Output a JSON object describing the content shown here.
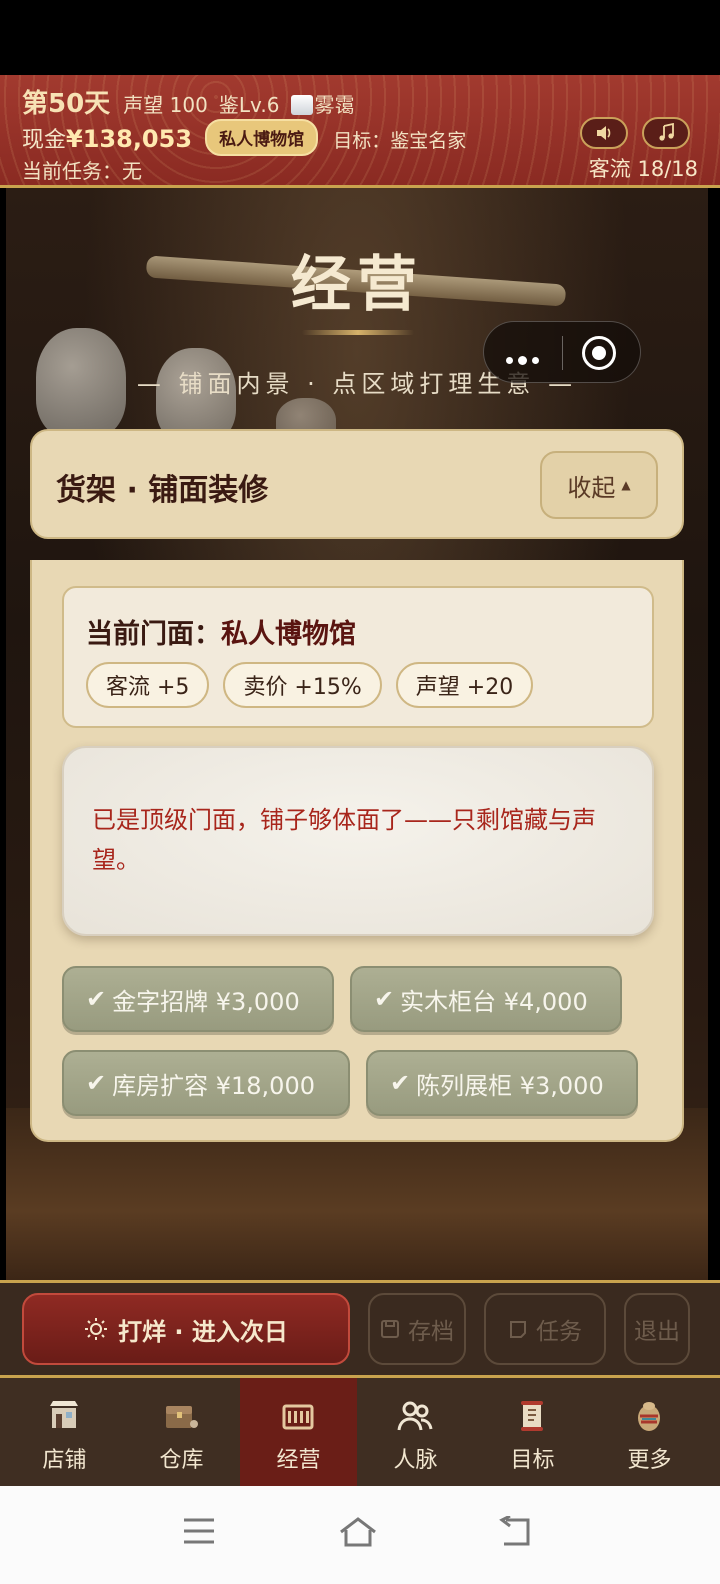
{
  "header": {
    "day": "第50天",
    "reputation": "声望 100",
    "appraisal_level": "鉴Lv.6",
    "weather": "雾霭",
    "cash_label": "现金",
    "cash_value": "¥138,053",
    "museum_badge": "私人博物馆",
    "goal": "目标：鉴宝名家",
    "current_task": "当前任务：无",
    "visitor_flow": "客流 18/18",
    "sound_icon": "speaker-icon",
    "music_icon": "music-note-icon"
  },
  "scene": {
    "title": "经营",
    "subtitle": "— 铺面内景 · 点区域打理生意 —"
  },
  "shelf_panel": {
    "title": "货架 · 铺面装修",
    "collapse_label": "收起",
    "storefront_label": "当前门面：",
    "storefront_name": "私人博物馆",
    "bonuses": [
      "客流 +5",
      "卖价 +15%",
      "声望 +20"
    ],
    "note": "已是顶级门面，铺子够体面了——只剩馆藏与声望。",
    "upgrades": [
      {
        "label": "金字招牌 ¥3,000",
        "done": true
      },
      {
        "label": "实木柜台 ¥4,000",
        "done": true
      },
      {
        "label": "库房扩容 ¥18,000",
        "done": true
      },
      {
        "label": "陈列展柜 ¥3,000",
        "done": true
      }
    ]
  },
  "actions": {
    "end_day": "打烊 · 进入次日",
    "save": "存档",
    "tasks": "任务",
    "quit": "退出"
  },
  "tabs": [
    {
      "label": "店铺",
      "icon": "shop-icon",
      "active": false
    },
    {
      "label": "仓库",
      "icon": "warehouse-chest-icon",
      "active": false
    },
    {
      "label": "经营",
      "icon": "abacus-icon",
      "active": true
    },
    {
      "label": "人脉",
      "icon": "people-icon",
      "active": false
    },
    {
      "label": "目标",
      "icon": "scroll-icon",
      "active": false
    },
    {
      "label": "更多",
      "icon": "more-vase-icon",
      "active": false
    }
  ],
  "colors": {
    "header_red": "#9a3328",
    "gold": "#c9a34e",
    "panel": "#e8d8b4",
    "note_text": "#a8261c",
    "active_tab": "#6a1e17"
  }
}
